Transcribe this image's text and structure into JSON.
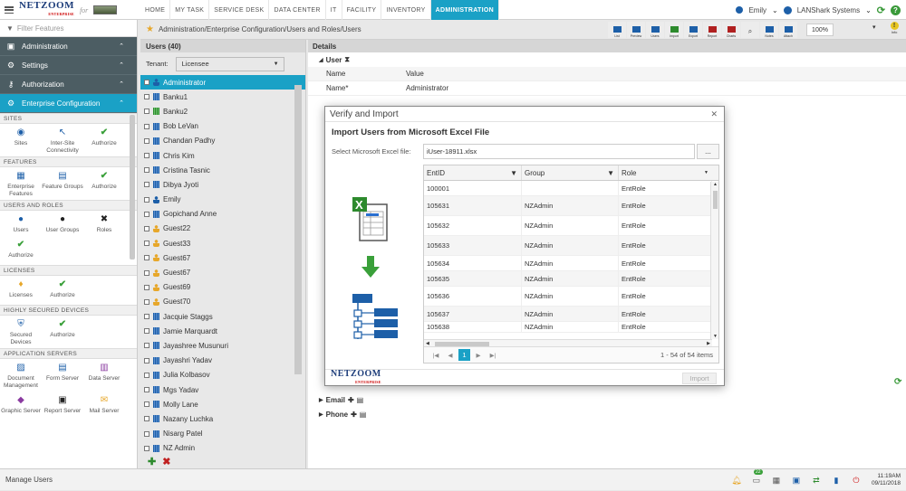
{
  "topbar": {
    "logo": "NETZOOM",
    "logo_sub": "ENTERPRISE",
    "logo_for": "for",
    "nav": [
      "HOME",
      "MY TASK",
      "SERVICE DESK",
      "DATA CENTER",
      "IT",
      "FACILITY",
      "INVENTORY",
      "ADMINISTRATION"
    ],
    "active_nav": "ADMINISTRATION",
    "user": "Emily",
    "org": "LANShark Systems"
  },
  "sidebar": {
    "filter_placeholder": "Filter Features",
    "menu": [
      {
        "label": "Administration",
        "icon": "admin-icon"
      },
      {
        "label": "Settings",
        "icon": "settings-icon"
      },
      {
        "label": "Authorization",
        "icon": "key-icon"
      },
      {
        "label": "Enterprise Configuration",
        "icon": "gear-icon",
        "active": true
      }
    ],
    "sections": [
      {
        "title": "SITES",
        "tiles": [
          {
            "label": "Sites",
            "icon": "sites-icon"
          },
          {
            "label": "Inter-Site Connectivity",
            "icon": "connectivity-icon"
          },
          {
            "label": "Authorize",
            "icon": "check-icon"
          }
        ]
      },
      {
        "title": "FEATURES",
        "tiles": [
          {
            "label": "Enterprise Features",
            "icon": "features-icon"
          },
          {
            "label": "Feature Groups",
            "icon": "feature-groups-icon"
          },
          {
            "label": "Authorize",
            "icon": "check-icon"
          }
        ]
      },
      {
        "title": "USERS AND ROLES",
        "tiles": [
          {
            "label": "Users",
            "icon": "user-icon"
          },
          {
            "label": "User Groups",
            "icon": "user-groups-icon"
          },
          {
            "label": "Roles",
            "icon": "roles-icon"
          },
          {
            "label": "Authorize",
            "icon": "check-icon"
          }
        ]
      },
      {
        "title": "LICENSES",
        "tiles": [
          {
            "label": "Licenses",
            "icon": "license-icon"
          },
          {
            "label": "Authorize",
            "icon": "check-icon"
          }
        ]
      },
      {
        "title": "HIGHLY SECURED DEVICES",
        "tiles": [
          {
            "label": "Secured Devices",
            "icon": "shield-icon"
          },
          {
            "label": "Authorize",
            "icon": "check-icon"
          }
        ]
      },
      {
        "title": "APPLICATION SERVERS",
        "tiles": [
          {
            "label": "Document Management",
            "icon": "document-icon"
          },
          {
            "label": "Form Server",
            "icon": "form-icon"
          },
          {
            "label": "Data Server",
            "icon": "data-server-icon"
          },
          {
            "label": "Graphic Server",
            "icon": "graphic-icon"
          },
          {
            "label": "Report Server",
            "icon": "report-icon"
          },
          {
            "label": "Mail Server",
            "icon": "mail-icon"
          }
        ]
      }
    ]
  },
  "breadcrumb": "Administration/Enterprise Configuration/Users and Roles/Users",
  "toolbar": {
    "buttons": [
      "List",
      "Preview",
      "Users",
      "Import",
      "Export",
      "Report",
      "Charts",
      "",
      "Notes",
      "Attach"
    ],
    "zoom": "100%",
    "info": "Info"
  },
  "users": {
    "header": "Users (40)",
    "tenant_label": "Tenant:",
    "tenant_value": "Licensee",
    "list": [
      {
        "name": "Administrator",
        "type": "person",
        "active": true
      },
      {
        "name": "Banku1",
        "type": "building"
      },
      {
        "name": "Banku2",
        "type": "building-green"
      },
      {
        "name": "Bob LeVan",
        "type": "building"
      },
      {
        "name": "Chandan Padhy",
        "type": "building"
      },
      {
        "name": "Chris Kim",
        "type": "building"
      },
      {
        "name": "Cristina Tasnic",
        "type": "building"
      },
      {
        "name": "Dibya Jyoti",
        "type": "building"
      },
      {
        "name": "Emily",
        "type": "person"
      },
      {
        "name": "Gopichand Anne",
        "type": "building"
      },
      {
        "name": "Guest22",
        "type": "guest"
      },
      {
        "name": "Guest33",
        "type": "guest"
      },
      {
        "name": "Guest67",
        "type": "guest"
      },
      {
        "name": "Guest67",
        "type": "guest"
      },
      {
        "name": "Guest69",
        "type": "guest"
      },
      {
        "name": "Guest70",
        "type": "guest"
      },
      {
        "name": "Jacquie Staggs",
        "type": "building"
      },
      {
        "name": "Jamie Marquardt",
        "type": "building"
      },
      {
        "name": "Jayashree Musunuri",
        "type": "building"
      },
      {
        "name": "Jayashri Yadav",
        "type": "building"
      },
      {
        "name": "Julia Kolbasov",
        "type": "building"
      },
      {
        "name": "Mgs Yadav",
        "type": "building"
      },
      {
        "name": "Molly Lane",
        "type": "building"
      },
      {
        "name": "Nazany Luchka",
        "type": "building"
      },
      {
        "name": "Nisarg Patel",
        "type": "building"
      },
      {
        "name": "NZ Admin",
        "type": "building"
      }
    ]
  },
  "details": {
    "header": "Details",
    "section_user": "User",
    "col_name": "Name",
    "col_value": "Value",
    "row_label": "Name*",
    "row_value": "Administrator",
    "section_email": "Email",
    "section_phone": "Phone"
  },
  "modal": {
    "title": "Verify and Import",
    "subtitle": "Import Users from Microsoft Excel File",
    "file_label": "Select Microsoft Excel file:",
    "file_value": "iUser-18911.xlsx",
    "browse": "...",
    "columns": [
      "EntID",
      "Group",
      "Role"
    ],
    "rows": [
      [
        "100001",
        "",
        "EntRole"
      ],
      [
        "105631",
        "NZAdmin",
        "EntRole"
      ],
      [
        "105632",
        "NZAdmin",
        "EntRole"
      ],
      [
        "105633",
        "NZAdmin",
        "EntRole"
      ],
      [
        "105634",
        "NZAdmin",
        "EntRole"
      ],
      [
        "105635",
        "NZAdmin",
        "EntRole"
      ],
      [
        "105636",
        "NZAdmin",
        "EntRole"
      ],
      [
        "105637",
        "NZAdmin",
        "EntRole"
      ],
      [
        "105638",
        "NZAdmin",
        "EntRole"
      ]
    ],
    "page": "1",
    "pager_info": "1 - 54 of 54 items",
    "footer_logo": "NETZOOM",
    "footer_logo_sub": "ENTERPRISE",
    "import": "Import"
  },
  "status": {
    "text": "Manage Users",
    "badge": "22",
    "time": "11:19AM",
    "date": "09/11/2018"
  },
  "colors": {
    "accent": "#1aa1c6",
    "menu_bg": "#4c5d63",
    "brand_blue": "#1d3d7a",
    "check_green": "#3aa03a"
  }
}
